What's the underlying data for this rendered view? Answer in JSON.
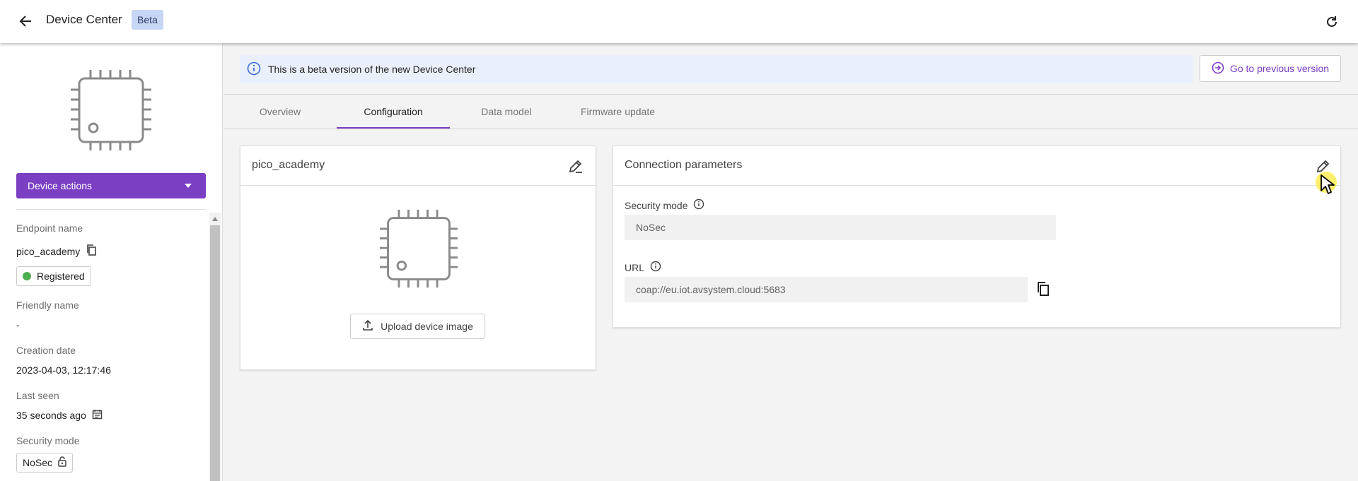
{
  "header": {
    "title": "Device Center",
    "badge": "Beta"
  },
  "sidebar": {
    "actions_label": "Device actions",
    "fields": {
      "endpoint_label": "Endpoint name",
      "endpoint_value": "pico_academy",
      "status": "Registered",
      "friendly_label": "Friendly name",
      "friendly_value": "-",
      "creation_label": "Creation date",
      "creation_value": "2023-04-03, 12:17:46",
      "lastseen_label": "Last seen",
      "lastseen_value": "35 seconds ago",
      "security_label": "Security mode",
      "security_value": "NoSec"
    }
  },
  "main": {
    "banner_text": "This is a beta version of the new Device Center",
    "prev_version_label": "Go to previous version",
    "tabs": [
      {
        "label": "Overview"
      },
      {
        "label": "Configuration"
      },
      {
        "label": "Data model"
      },
      {
        "label": "Firmware update"
      }
    ],
    "active_tab": "Configuration",
    "device_card": {
      "title": "pico_academy",
      "upload_label": "Upload device image"
    },
    "connection_card": {
      "title": "Connection parameters",
      "security_label": "Security mode",
      "security_value": "NoSec",
      "url_label": "URL",
      "url_value": "coap://eu.iot.avsystem.cloud:5683"
    }
  },
  "colors": {
    "accent": "#7b3fc4",
    "banner_bg": "#eaf0fb",
    "status_green": "#4caf50"
  }
}
